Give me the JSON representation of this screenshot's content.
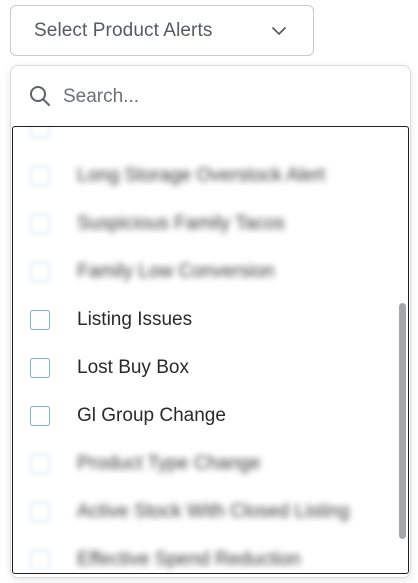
{
  "dropdown": {
    "trigger_label": "Select Product Alerts",
    "search_placeholder": "Search...",
    "items": [
      {
        "label": "",
        "blurred": true
      },
      {
        "label": "Long Storage Overstock Alert",
        "blurred": true
      },
      {
        "label": "Suspicious Family Tacos",
        "blurred": true
      },
      {
        "label": "Family Low Conversion",
        "blurred": true
      },
      {
        "label": "Listing Issues",
        "blurred": false
      },
      {
        "label": "Lost Buy Box",
        "blurred": false
      },
      {
        "label": "Gl Group Change",
        "blurred": false
      },
      {
        "label": "Product Type Change",
        "blurred": true
      },
      {
        "label": "Active Stock With Closed Listing",
        "blurred": true
      },
      {
        "label": "Effective Spend Reduction",
        "blurred": true
      }
    ]
  },
  "colors": {
    "checkbox_border": "#7fb0d3",
    "scrollbar": "#a4a7aa"
  },
  "icons": {
    "trigger": "chevron-down-icon",
    "search": "search-icon"
  }
}
